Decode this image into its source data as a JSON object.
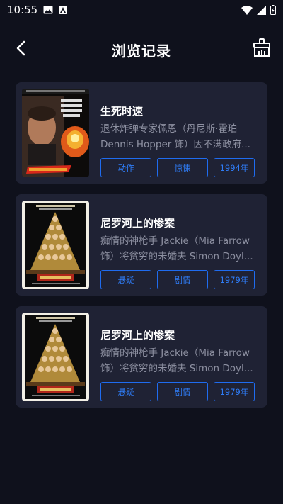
{
  "status": {
    "time": "10:55",
    "left_icons": [
      "image-icon",
      "app-notification-icon"
    ],
    "right_icons": [
      "wifi-icon",
      "signal-icon",
      "battery-icon"
    ]
  },
  "header": {
    "title": "浏览记录",
    "back_icon": "chevron-left-icon",
    "clear_icon": "broom-icon"
  },
  "colors": {
    "background": "#0f111c",
    "card": "#1f2234",
    "tag_border": "#1f6cf0",
    "tag_text": "#2f7cf6",
    "desc_text": "#8d90a1"
  },
  "history": [
    {
      "title": "生死时速",
      "desc_line1": "退休炸弹专家佩恩（丹尼斯·霍珀",
      "desc_line2": "Dennis Hopper 饰）因不满政府...",
      "tags": [
        "动作",
        "惊悚",
        "1994年"
      ],
      "poster": "speed-poster"
    },
    {
      "title": "尼罗河上的惨案",
      "desc_line1": "痴情的神枪手 Jackie（Mia Farrow",
      "desc_line2": "饰）将贫穷的未婚夫 Simon Doyl...",
      "tags": [
        "悬疑",
        "剧情",
        "1979年"
      ],
      "poster": "death-on-the-nile-poster"
    },
    {
      "title": "尼罗河上的惨案",
      "desc_line1": "痴情的神枪手 Jackie（Mia Farrow",
      "desc_line2": "饰）将贫穷的未婚夫 Simon Doyl...",
      "tags": [
        "悬疑",
        "剧情",
        "1979年"
      ],
      "poster": "death-on-the-nile-poster"
    }
  ]
}
